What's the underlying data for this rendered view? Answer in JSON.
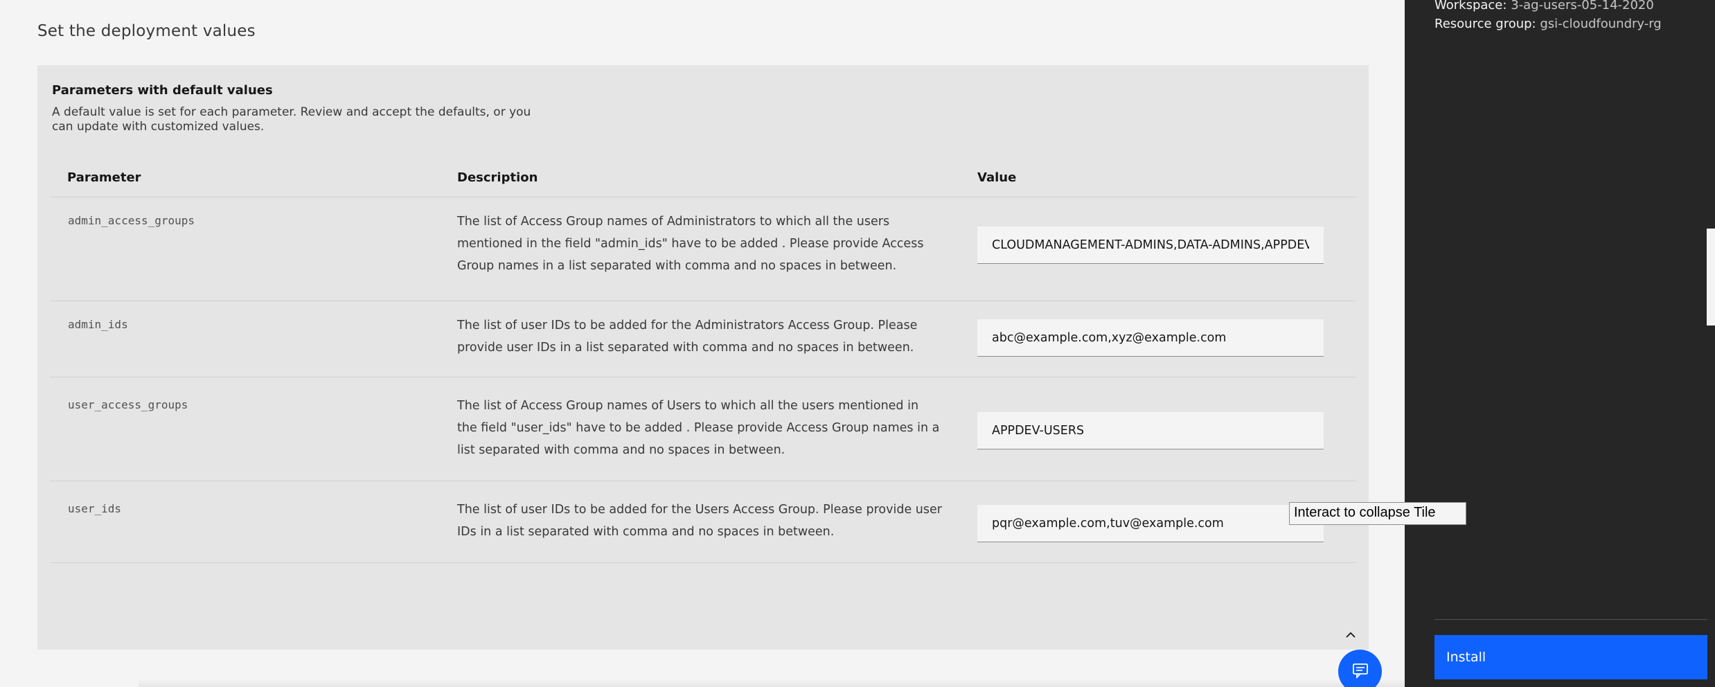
{
  "page": {
    "title": "Set the deployment values"
  },
  "tile": {
    "title": "Parameters with default values",
    "description": "A default value is set for each parameter. Review and accept the defaults, or you can update with customized values.",
    "collapse_tooltip": "Interact to collapse Tile"
  },
  "table": {
    "headers": {
      "parameter": "Parameter",
      "description": "Description",
      "value": "Value"
    },
    "rows": [
      {
        "parameter": "admin_access_groups",
        "description": "The list of Access Group names of Administrators to which all the users mentioned in the field \"admin_ids\" have to be added . Please provide Access Group names in a list separated with comma and no spaces in between.",
        "value": "CLOUDMANAGEMENT-ADMINS,DATA-ADMINS,APPDEV-ADMINS"
      },
      {
        "parameter": "admin_ids",
        "description": "The list of user IDs to be added for the Administrators Access Group. Please provide user IDs in a list separated with comma and no spaces in between.",
        "value": "abc@example.com,xyz@example.com"
      },
      {
        "parameter": "user_access_groups",
        "description": "The list of Access Group names of Users to which all the users mentioned in the field \"user_ids\" have to be added . Please provide Access Group names in a list separated with comma and no spaces in between.",
        "value": "APPDEV-USERS"
      },
      {
        "parameter": "user_ids",
        "description": "The list of user IDs to be added for the Users Access Group. Please provide user IDs in a list separated with comma and no spaces in between.",
        "value": "pqr@example.com,tuv@example.com"
      }
    ]
  },
  "sidebar": {
    "workspace_label": "Workspace:",
    "workspace_value": "3-ag-users-05-14-2020",
    "resource_group_label": "Resource group:",
    "resource_group_value": "gsi-cloudfoundry-rg",
    "install_label": "Install"
  },
  "icons": {
    "collapse": "chevron-up-icon",
    "feedback": "chat-icon"
  },
  "colors": {
    "accent": "#0f62fe",
    "panel": "#262626",
    "tile": "#e5e5e5",
    "background": "#f4f4f4"
  }
}
